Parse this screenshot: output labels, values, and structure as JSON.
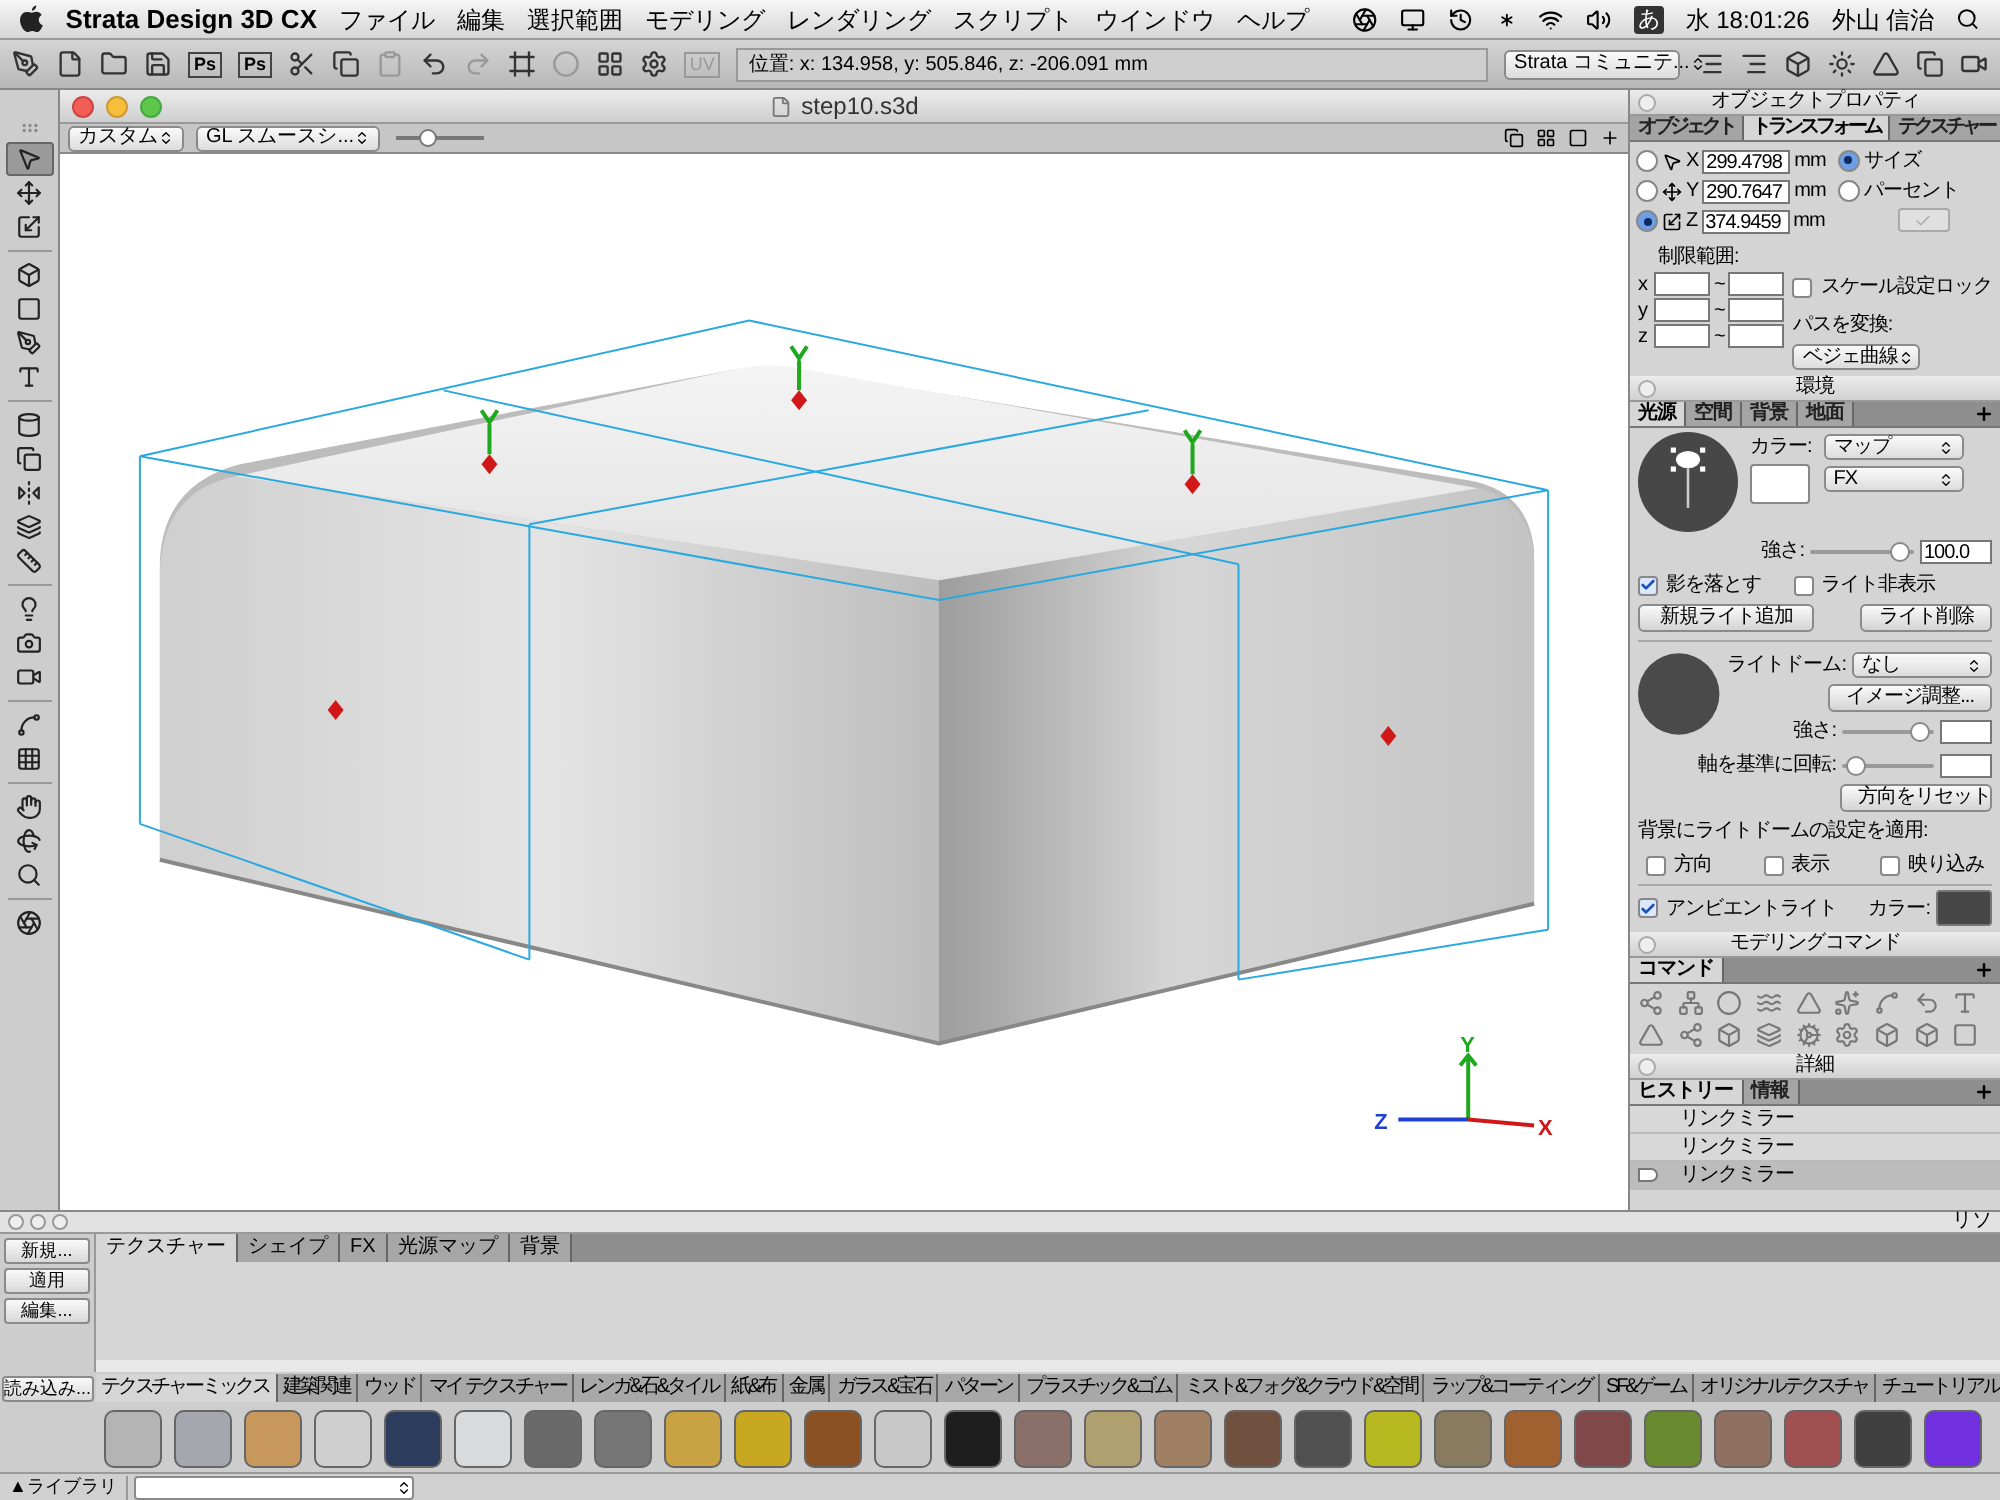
{
  "menu_bar": {
    "app_name": "Strata Design 3D CX",
    "items": [
      "ファイル",
      "編集",
      "選択範囲",
      "モデリング",
      "レンダリング",
      "スクリプト",
      "ウインドウ",
      "ヘルプ"
    ],
    "input_mode": "あ",
    "clock": "水 18:01:26",
    "user": "外山 信治"
  },
  "toolbar": {
    "photoshop_buttons": [
      "Ps",
      "Ps"
    ],
    "uv_button": "UV",
    "position": "位置: x: 134.958, y: 505.846, z: -206.091 mm",
    "community": "Strata コミュニテ..."
  },
  "tools": [
    {
      "selected": true
    },
    {
      "selected": false
    },
    {
      "selected": false
    },
    {
      "selected": false
    },
    {
      "selected": false
    },
    {
      "selected": false
    },
    {
      "selected": false
    },
    {
      "selected": false
    },
    {
      "selected": false
    },
    {
      "selected": false
    },
    {
      "selected": false
    },
    {
      "selected": false
    },
    {
      "selected": false
    },
    {
      "selected": false
    },
    {
      "selected": false
    },
    {
      "selected": false
    },
    {
      "selected": false
    },
    {
      "selected": false
    },
    {
      "selected": false
    },
    {
      "selected": false
    },
    {
      "selected": false
    }
  ],
  "document": {
    "title": "step10.s3d",
    "view": "カスタム",
    "render_mode": "GL スムースシ...",
    "axes": [
      "Y",
      "Z",
      "X"
    ]
  },
  "object_properties": {
    "title": "オブジェクトプロパティ",
    "tabs": [
      {
        "label": "オブジェクト",
        "selected": false
      },
      {
        "label": "トランスフォーム",
        "selected": true
      },
      {
        "label": "テクスチャー",
        "selected": false
      }
    ],
    "tool_modes": [
      {
        "selected": false
      },
      {
        "selected": false
      },
      {
        "selected": true
      }
    ],
    "axes": [
      {
        "axis": "X",
        "value": "299.4798",
        "unit": "mm"
      },
      {
        "axis": "Y",
        "value": "290.7647",
        "unit": "mm"
      },
      {
        "axis": "Z",
        "value": "374.9459",
        "unit": "mm"
      }
    ],
    "modes": [
      {
        "label": "サイズ",
        "selected": true
      },
      {
        "label": "パーセント",
        "selected": false
      }
    ],
    "limits_label": "制限範囲:",
    "limits": [
      {
        "axis": "x",
        "separator": "~"
      },
      {
        "axis": "y",
        "separator": "~"
      },
      {
        "axis": "z",
        "separator": "~"
      }
    ],
    "scale_lock": {
      "label": "スケール設定ロック",
      "checked": false
    },
    "path_label": "パスを変換:",
    "path_value": "ベジェ曲線"
  },
  "environment": {
    "title": "環境",
    "tabs": [
      {
        "label": "光源",
        "selected": true
      },
      {
        "label": "空間",
        "selected": false
      },
      {
        "label": "背景",
        "selected": false
      },
      {
        "label": "地面",
        "selected": false
      }
    ],
    "color_label": "カラー:",
    "map": "マップ",
    "fx": "FX",
    "intensity_label": "強さ:",
    "intensity": {
      "level": 0.95
    },
    "intensity_value": "100.0",
    "cast_shadow": {
      "label": "影を落とす",
      "checked": true
    },
    "hide_light": {
      "label": "ライト非表示",
      "checked": false
    },
    "buttons": [
      "新規ライト追加",
      "ライト削除"
    ],
    "dome_label": "ライトドーム:",
    "dome_value": "なし",
    "image_adjust": "イメージ調整...",
    "dome_intensity_label": "強さ:",
    "dome_intensity": {
      "level": 0.95
    },
    "rotate_label": "軸を基準に回転:",
    "rotate": {
      "level": 0.05
    },
    "reset": "方向をリセット",
    "apply_label": "背景にライトドームの設定を適用:",
    "apply_options": [
      {
        "label": "方向",
        "checked": false
      },
      {
        "label": "表示",
        "checked": false
      },
      {
        "label": "映り込み",
        "checked": false
      }
    ],
    "ambient": {
      "label": "アンビエントライト",
      "checked": true
    },
    "ambient_color_label": "カラー:"
  },
  "modeling": {
    "title": "モデリングコマンド",
    "tab": "コマンド"
  },
  "details": {
    "title": "詳細",
    "tabs": [
      {
        "label": "ヒストリー",
        "selected": true
      },
      {
        "label": "情報",
        "selected": false
      }
    ],
    "history": [
      {
        "label": "リンクミラー",
        "selected": false
      },
      {
        "label": "リンクミラー",
        "selected": false
      },
      {
        "label": "リンクミラー",
        "selected": true
      }
    ]
  },
  "library": {
    "side_title": "リソ",
    "buttons": [
      "新規...",
      "適用",
      "編集..."
    ],
    "tabs": [
      {
        "label": "テクスチャー",
        "selected": true
      },
      {
        "label": "シェイプ",
        "selected": false
      },
      {
        "label": "FX",
        "selected": false
      },
      {
        "label": "光源マップ",
        "selected": false
      },
      {
        "label": "背景",
        "selected": false
      }
    ],
    "load": "読み込み...",
    "categories": [
      {
        "label": "テクスチャーミックス",
        "selected": true
      },
      {
        "label": "建築関連",
        "selected": false
      },
      {
        "label": "ウッド",
        "selected": false
      },
      {
        "label": "マイ テクスチャー",
        "selected": false
      },
      {
        "label": "レンガ&石&タイル",
        "selected": false
      },
      {
        "label": "紙&布",
        "selected": false
      },
      {
        "label": "金属",
        "selected": false
      },
      {
        "label": "ガラス&宝石",
        "selected": false
      },
      {
        "label": "パターン",
        "selected": false
      },
      {
        "label": "プラスチック&ゴム",
        "selected": false
      },
      {
        "label": "ミスト&フォグ&クラウド&空間",
        "selected": false
      },
      {
        "label": "ラップ&コーティング",
        "selected": false
      },
      {
        "label": "SF&ゲーム",
        "selected": false
      },
      {
        "label": "オリジナルテクスチャ",
        "selected": false
      },
      {
        "label": "チュートリアル",
        "selected": false
      }
    ],
    "swatches": [
      {
        "color": "#b4b4b4"
      },
      {
        "color": "#a4a8ae"
      },
      {
        "color": "#c8975c"
      },
      {
        "color": "#cfcfcf"
      },
      {
        "color": "#2c3c5c"
      },
      {
        "color": "#d8dadc"
      },
      {
        "color": "#6a6a6a"
      },
      {
        "color": "#767676"
      },
      {
        "color": "#c9a244"
      },
      {
        "color": "#c8a820"
      },
      {
        "color": "#8a5224"
      },
      {
        "color": "#c8c8c8"
      },
      {
        "color": "#1e1e1e"
      },
      {
        "color": "#8a7068"
      },
      {
        "color": "#b0a070"
      },
      {
        "color": "#a08064"
      },
      {
        "color": "#70503e"
      },
      {
        "color": "#505050"
      },
      {
        "color": "#b8b820"
      },
      {
        "color": "#8a7a60"
      },
      {
        "color": "#a06030"
      },
      {
        "color": "#804848"
      },
      {
        "color": "#6a8a30"
      },
      {
        "color": "#907060"
      },
      {
        "color": "#a05050"
      },
      {
        "color": "#404040"
      },
      {
        "color": "#7030e0"
      }
    ],
    "footer": "▲ライブラリ"
  }
}
